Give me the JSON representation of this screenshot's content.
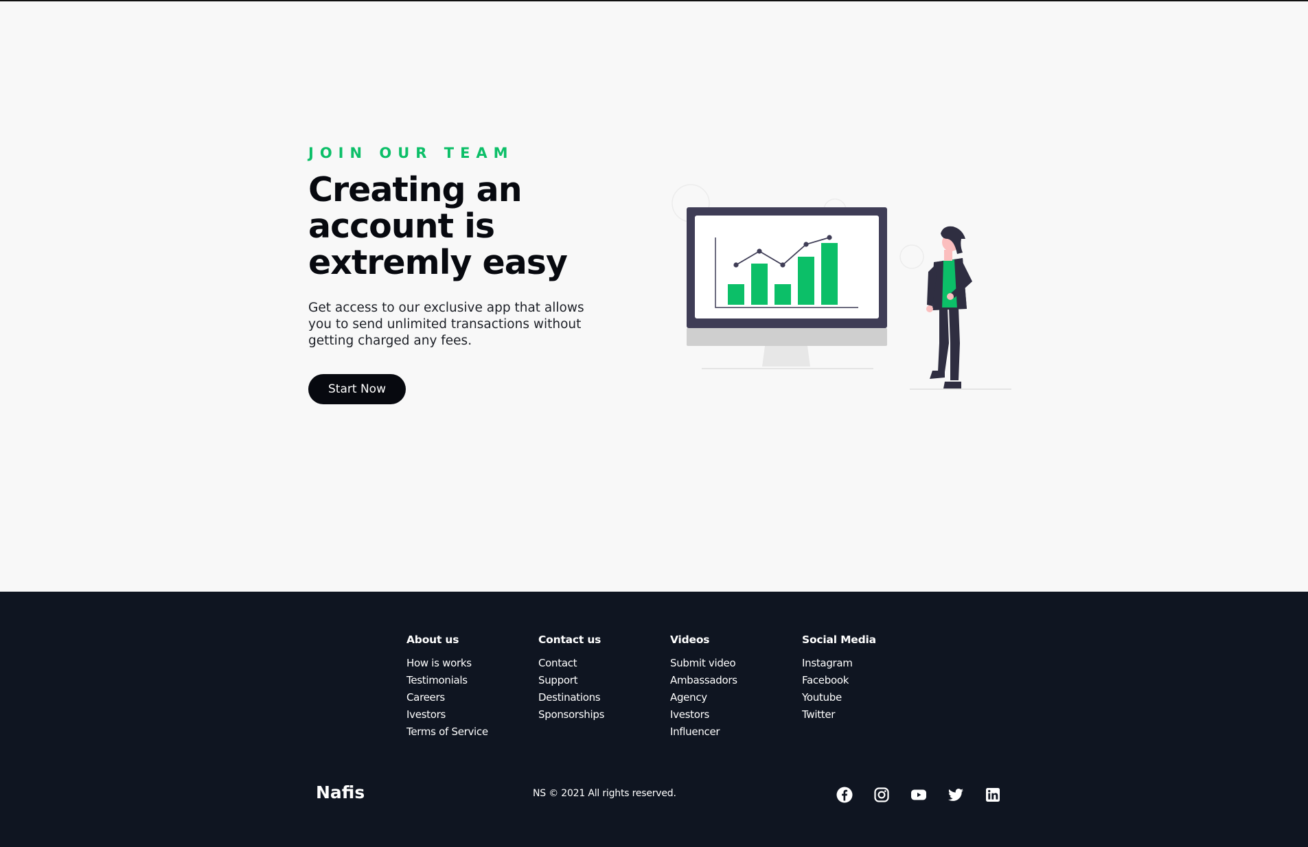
{
  "hero": {
    "eyebrow": "JOIN OUR TEAM",
    "headline": "Creating an account is extremly easy",
    "description": "Get access to our exclusive app that allows you to send unlimited transactions without getting charged any fees.",
    "cta_label": "Start Now"
  },
  "illustration": {
    "bar_values": [
      3,
      6,
      3,
      7,
      9
    ],
    "line_values": [
      5,
      7,
      5,
      8,
      9
    ],
    "accent_color": "#0cbf68",
    "monitor_color": "#3f3d56"
  },
  "footer": {
    "columns": [
      {
        "title": "About us",
        "links": [
          "How is works",
          "Testimonials",
          "Careers",
          "Ivestors",
          "Terms of Service"
        ]
      },
      {
        "title": "Contact us",
        "links": [
          "Contact",
          "Support",
          "Destinations",
          "Sponsorships"
        ]
      },
      {
        "title": "Videos",
        "links": [
          "Submit video",
          "Ambassadors",
          "Agency",
          "Ivestors",
          "Influencer"
        ]
      },
      {
        "title": "Social Media",
        "links": [
          "Instagram",
          "Facebook",
          "Youtube",
          "Twitter"
        ]
      }
    ],
    "brand": "Nafis",
    "copyright": "NS © 2021 All rights reserved.",
    "social_icons": [
      "facebook-icon",
      "instagram-icon",
      "youtube-icon",
      "twitter-icon",
      "linkedin-icon"
    ]
  },
  "colors": {
    "accent": "#0cbf68",
    "dark": "#07090f",
    "footer_bg": "#0f1521",
    "page_bg": "#f8f8f8"
  }
}
